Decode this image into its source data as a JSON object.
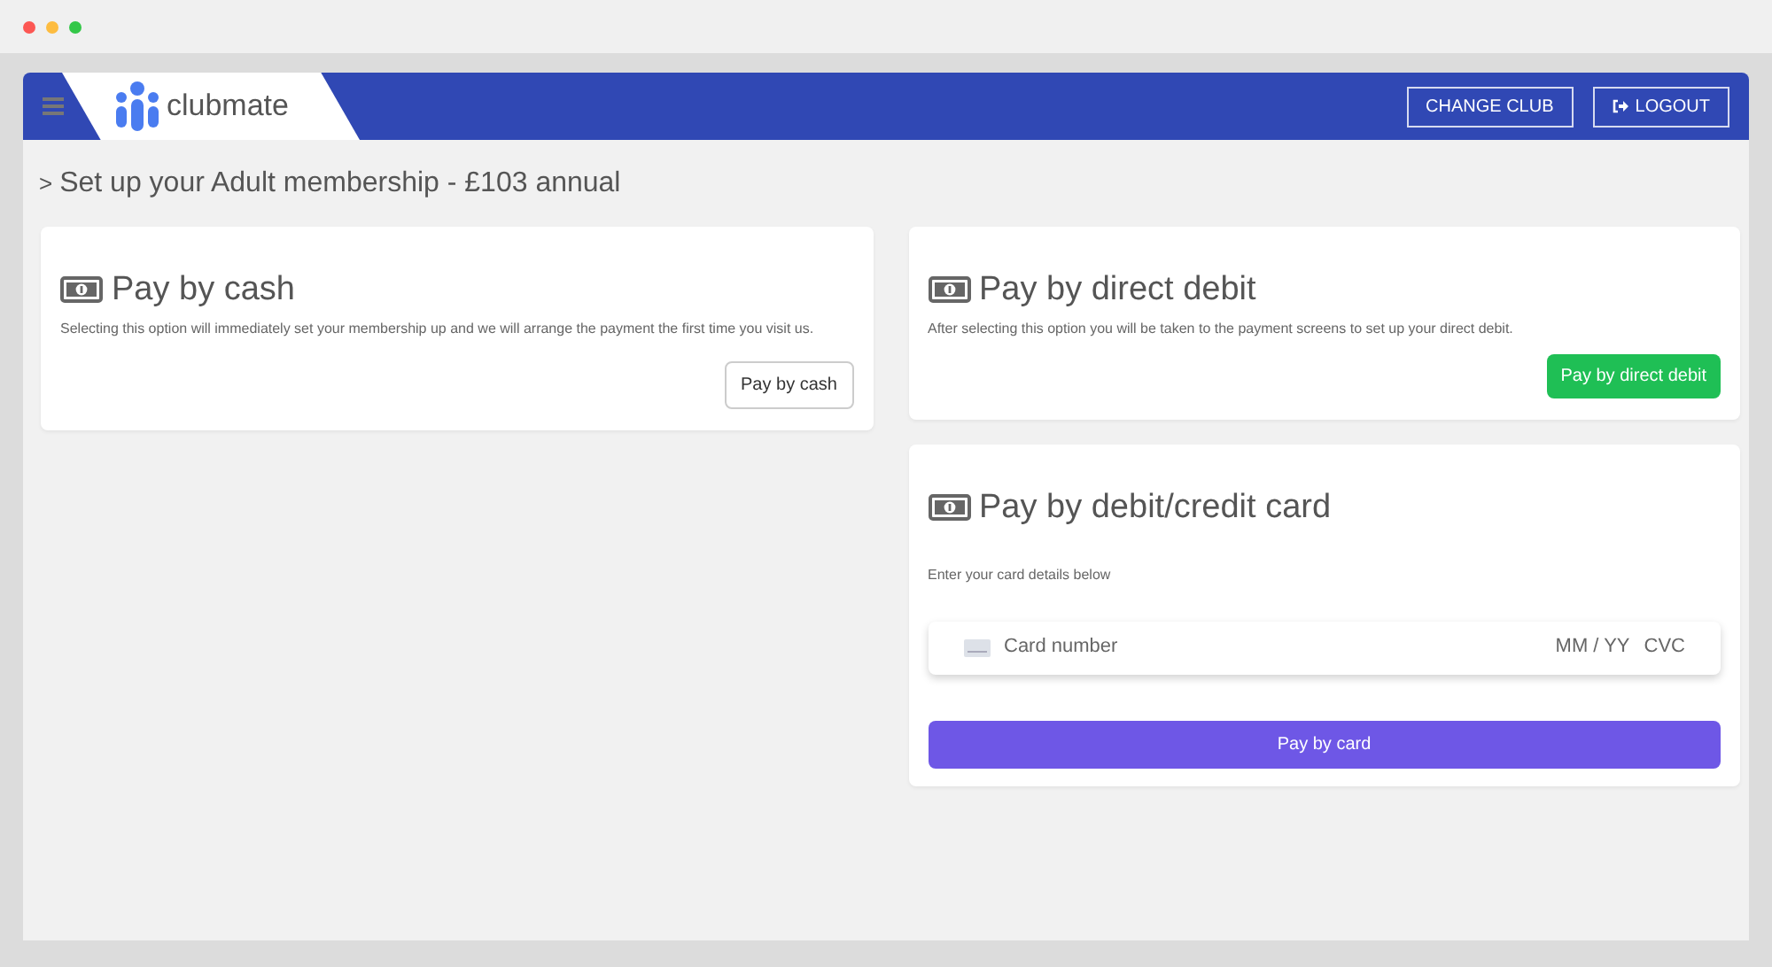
{
  "header": {
    "logo": "clubmate",
    "buttons": [
      {
        "kind": "plain",
        "label": "CHANGE CLUB"
      },
      {
        "kind": "logout",
        "label": "LOGOUT"
      }
    ]
  },
  "page_title": {
    "chevron": ">",
    "text": "Set up your Adult membership - £103 annual"
  },
  "columns": [
    {
      "cards": [
        {
          "kind": "cash",
          "title": "Pay by cash",
          "description": "Selecting this option will immediately set your membership up and we will arrange the payment the first time you visit us.",
          "button": "Pay by cash"
        }
      ]
    },
    {
      "cards": [
        {
          "kind": "debit",
          "title": "Pay by direct debit",
          "description": "After selecting this option you will be taken to the payment screens to set up your direct debit.",
          "button": "Pay by direct debit"
        },
        {
          "kind": "card",
          "title": "Pay by debit/credit card",
          "description": "Enter your card details below",
          "card_field": {
            "number_placeholder": "Card number",
            "expiry_placeholder": "MM / YY",
            "cvc_placeholder": "CVC"
          },
          "button": "Pay by card"
        }
      ]
    }
  ]
}
